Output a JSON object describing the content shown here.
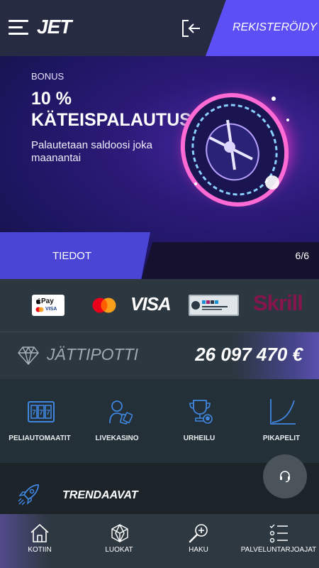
{
  "header": {
    "logo": "JET",
    "menu_icon": "hamburger-menu-icon",
    "login_icon": "login-icon",
    "register_label": "REKISTERÖIDY"
  },
  "banner": {
    "eyebrow": "BONUS",
    "title": "10 % KÄTEISPALAUTUS",
    "subtitle": "Palautetaan saldoosi joka maanantai",
    "image_icon": "roulette-wheel-image",
    "cta_label": "TIEDOT",
    "slide_counter": "6/6"
  },
  "payments": {
    "apple_pay_label": "Pay",
    "apple_pay_sub": "VISA",
    "mastercard_icon": "mastercard-logo",
    "visa_label": "VISA",
    "rapid_icon": "rapid-transfer-logo",
    "skrill_label": "Skrill"
  },
  "jackpot": {
    "icon": "diamond-icon",
    "label": "JÄTTIPOTTI",
    "value": "26 097 470 €"
  },
  "categories": [
    {
      "label": "PELIAUTOMAATIT",
      "icon": "slot-machine-icon"
    },
    {
      "label": "LIVEKASINO",
      "icon": "live-dealer-icon"
    },
    {
      "label": "URHEILU",
      "icon": "trophy-icon"
    },
    {
      "label": "PIKAPELIT",
      "icon": "chart-curve-icon"
    }
  ],
  "trending": {
    "label": "TRENDAAVAT",
    "icon": "rocket-icon"
  },
  "support": {
    "icon": "headset-icon"
  },
  "bottom_nav": [
    {
      "label": "KOTIIN",
      "icon": "home-icon"
    },
    {
      "label": "LUOKAT",
      "icon": "dice-icon"
    },
    {
      "label": "HAKU",
      "icon": "search-icon"
    },
    {
      "label": "PALVELUNTARJOAJAT",
      "icon": "providers-list-icon"
    }
  ],
  "colors": {
    "accent": "#5b4ff5",
    "header_bg": "#262b42",
    "panel_bg": "#2c3740",
    "icon_blue": "#3f86e0",
    "skrill": "#86144d"
  }
}
